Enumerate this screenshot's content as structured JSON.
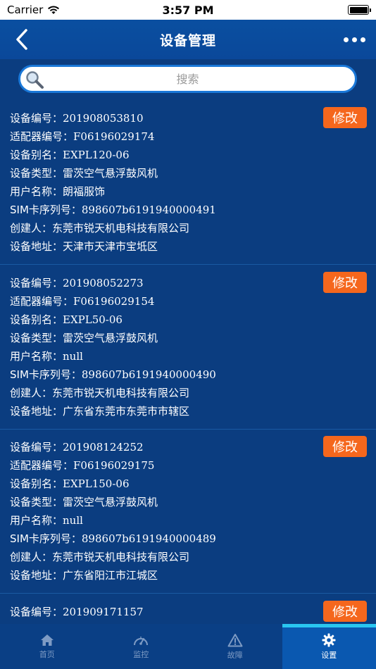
{
  "status_bar": {
    "carrier": "Carrier",
    "time": "3:57 PM"
  },
  "nav": {
    "title": "设备管理"
  },
  "search": {
    "placeholder": "搜索"
  },
  "labels": {
    "device_no": "设备编号：",
    "adapter_no": "适配器编号：",
    "alias": "设备别名：",
    "type": "设备类型：",
    "user": "用户名称：",
    "sim": "SIM卡序列号：",
    "creator": "创建人：",
    "address": "设备地址："
  },
  "edit_label": "修改",
  "devices": [
    {
      "device_no": "201908053810",
      "adapter_no": "F06196029174",
      "alias": "EXPL120-06",
      "type": "雷茨空气悬浮鼓风机",
      "user": "朗福服饰",
      "sim": "898607b6191940000491",
      "creator": "东莞市锐天机电科技有限公司",
      "address": "天津市天津市宝坻区"
    },
    {
      "device_no": "201908052273",
      "adapter_no": "F06196029154",
      "alias": "EXPL50-06",
      "type": "雷茨空气悬浮鼓风机",
      "user": "null",
      "sim": "898607b6191940000490",
      "creator": "东莞市锐天机电科技有限公司",
      "address": "广东省东莞市东莞市市辖区"
    },
    {
      "device_no": "201908124252",
      "adapter_no": "F06196029175",
      "alias": "EXPL150-06",
      "type": "雷茨空气悬浮鼓风机",
      "user": "null",
      "sim": "898607b6191940000489",
      "creator": "东莞市锐天机电科技有限公司",
      "address": "广东省阳江市江城区"
    },
    {
      "device_no": "201909171157"
    }
  ],
  "tabs": [
    {
      "label": "首页",
      "icon": "home-icon",
      "active": false
    },
    {
      "label": "监控",
      "icon": "gauge-icon",
      "active": false
    },
    {
      "label": "故障",
      "icon": "warning-icon",
      "active": false
    },
    {
      "label": "设置",
      "icon": "gear-icon",
      "active": true
    }
  ],
  "colors": {
    "background": "#0b3d80",
    "nav": "#0a4fa0",
    "edit_button": "#f5671d",
    "tab_active": "#0a58b0",
    "tab_indicator": "#29c6f0"
  }
}
